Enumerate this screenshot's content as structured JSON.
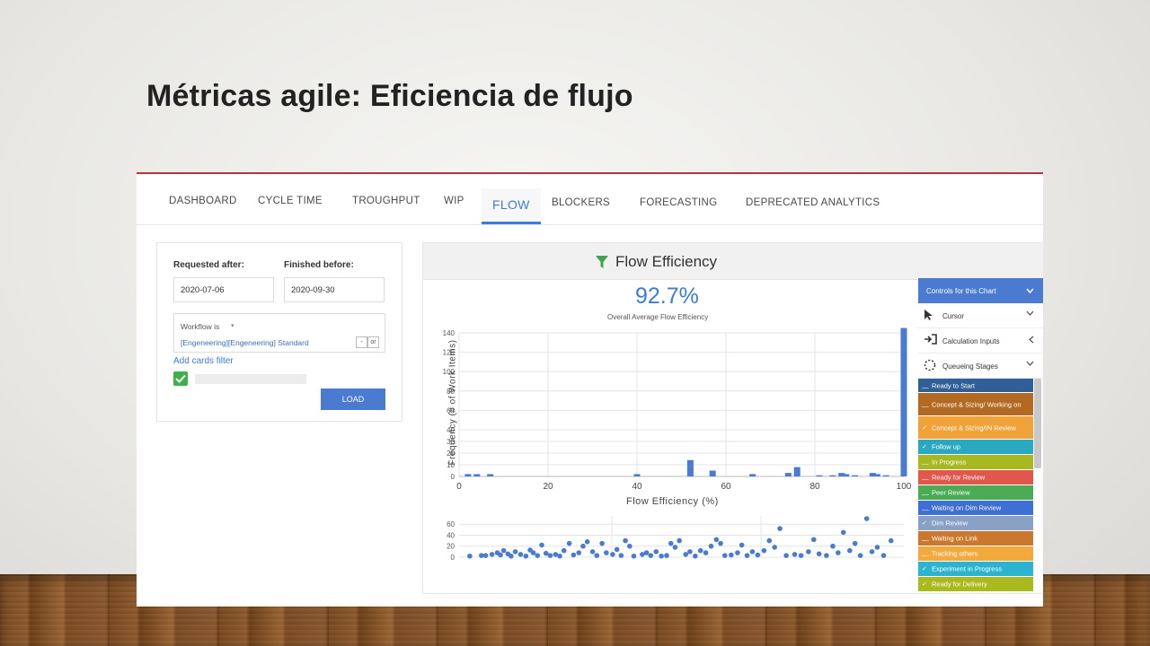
{
  "slide": {
    "title": "Métricas agile: Eficiencia de flujo"
  },
  "tabs": [
    {
      "label": "DASHBOARD"
    },
    {
      "label": "CYCLE TIME"
    },
    {
      "label": "TROUGHPUT"
    },
    {
      "label": "WIP"
    },
    {
      "label": "FLOW"
    },
    {
      "label": "BLOCKERS"
    },
    {
      "label": "FORECASTING"
    },
    {
      "label": "DEPRECATED ANALYTICS"
    }
  ],
  "active_tab": "FLOW",
  "filters": {
    "requested_after_label": "Requested after:",
    "requested_after_value": "2020-07-06",
    "finished_before_label": "Finished before:",
    "finished_before_value": "2020-09-30",
    "workflow_label": "Workflow is",
    "workflow_value": "[Engeneering][Engeneering] Standard",
    "add_filter_label": "Add cards filter",
    "load_label": "LOAD",
    "checkbox_checked": true
  },
  "chart_panel": {
    "title": "Flow Efficiency",
    "metric_value": "92.7%",
    "metric_label": "Overall Average Flow Efficiency"
  },
  "chart_data": [
    {
      "type": "bar",
      "xlabel": "Flow Efficiency (%)",
      "ylabel": "Frequency (# of Work Items)",
      "xlim": [
        0,
        100
      ],
      "ylim": [
        0,
        140
      ],
      "x_ticks": [
        0,
        20,
        40,
        60,
        80,
        100
      ],
      "y_ticks": [
        0,
        10,
        20,
        30,
        40,
        60,
        80,
        100,
        120,
        140
      ],
      "x": [
        2,
        4,
        7,
        40,
        52,
        57,
        66,
        74,
        76,
        81,
        84,
        86,
        87,
        89,
        93,
        94,
        96,
        100
      ],
      "values": [
        2,
        2,
        2,
        2,
        14,
        5,
        2,
        3,
        8,
        1,
        1,
        3,
        2,
        1,
        3,
        2,
        1,
        145
      ],
      "color": "#4a7bd0",
      "grid": true
    },
    {
      "type": "scatter",
      "y_ticks": [
        0,
        20,
        40,
        60
      ],
      "ylim": [
        0,
        75
      ],
      "points": [
        [
          0.5,
          2
        ],
        [
          1.6,
          3
        ],
        [
          2.0,
          3
        ],
        [
          2.6,
          5
        ],
        [
          3.1,
          8
        ],
        [
          3.4,
          4
        ],
        [
          3.7,
          12
        ],
        [
          4.1,
          6
        ],
        [
          4.4,
          2
        ],
        [
          4.8,
          10
        ],
        [
          5.3,
          5
        ],
        [
          5.8,
          2
        ],
        [
          6.2,
          13
        ],
        [
          6.5,
          8
        ],
        [
          6.9,
          3
        ],
        [
          7.3,
          22
        ],
        [
          7.7,
          7
        ],
        [
          8.1,
          3
        ],
        [
          8.6,
          5
        ],
        [
          9.0,
          2
        ],
        [
          9.4,
          12
        ],
        [
          9.9,
          25
        ],
        [
          10.3,
          4
        ],
        [
          10.8,
          8
        ],
        [
          11.2,
          20
        ],
        [
          11.6,
          28
        ],
        [
          12.1,
          10
        ],
        [
          12.5,
          3
        ],
        [
          13.0,
          25
        ],
        [
          13.4,
          8
        ],
        [
          14.0,
          5
        ],
        [
          14.4,
          14
        ],
        [
          14.8,
          3
        ],
        [
          15.2,
          30
        ],
        [
          15.6,
          20
        ],
        [
          16.0,
          2
        ],
        [
          16.8,
          5
        ],
        [
          17.2,
          8
        ],
        [
          17.6,
          3
        ],
        [
          18.1,
          10
        ],
        [
          18.6,
          2
        ],
        [
          19.1,
          3
        ],
        [
          19.5,
          25
        ],
        [
          19.9,
          18
        ],
        [
          20.3,
          30
        ],
        [
          20.9,
          5
        ],
        [
          21.3,
          10
        ],
        [
          21.8,
          2
        ],
        [
          22.3,
          12
        ],
        [
          22.8,
          8
        ],
        [
          23.3,
          20
        ],
        [
          23.8,
          32
        ],
        [
          24.2,
          25
        ],
        [
          24.6,
          3
        ],
        [
          25.2,
          4
        ],
        [
          25.8,
          8
        ],
        [
          26.2,
          22
        ],
        [
          26.7,
          3
        ],
        [
          27.2,
          10
        ],
        [
          27.7,
          4
        ],
        [
          28.3,
          12
        ],
        [
          28.8,
          30
        ],
        [
          29.3,
          18
        ],
        [
          29.8,
          52
        ],
        [
          30.4,
          3
        ],
        [
          31.2,
          5
        ],
        [
          31.8,
          3
        ],
        [
          32.5,
          10
        ],
        [
          33.0,
          32
        ],
        [
          33.5,
          6
        ],
        [
          34.2,
          3
        ],
        [
          34.8,
          20
        ],
        [
          35.3,
          8
        ],
        [
          35.8,
          45
        ],
        [
          36.4,
          12
        ],
        [
          36.9,
          25
        ],
        [
          37.4,
          3
        ],
        [
          38.0,
          70
        ],
        [
          38.5,
          10
        ],
        [
          39.0,
          18
        ],
        [
          39.6,
          3
        ],
        [
          40.3,
          30
        ]
      ],
      "color": "#4a7bd0",
      "grid": true
    }
  ],
  "controls": {
    "header": "Controls for this Chart",
    "items": [
      {
        "label": "Cursor",
        "icon": "cursor-icon"
      },
      {
        "label": "Calculation Inputs",
        "icon": "sign-in-icon"
      },
      {
        "label": "Queueing Stages",
        "icon": "dotted-circle-icon"
      }
    ],
    "stages": [
      {
        "label": "Ready to Start",
        "color": "#2f5f96",
        "mark": "__"
      },
      {
        "label": "Concept & Sizing/ Working on",
        "color": "#b26a22",
        "mark": "__"
      },
      {
        "label": "Concept & Sizing/IN Review",
        "color": "#f1a33a",
        "mark": "✓"
      },
      {
        "label": "Follow up",
        "color": "#2aa7c1",
        "mark": "✓"
      },
      {
        "label": "In Progress",
        "color": "#a7b820",
        "mark": "__"
      },
      {
        "label": "Ready for Review",
        "color": "#e2574c",
        "mark": "__"
      },
      {
        "label": "Peer Review",
        "color": "#4bab55",
        "mark": "__"
      },
      {
        "label": "Waiting on Dim Review",
        "color": "#3d6fd4",
        "mark": "__"
      },
      {
        "label": "Dim Review",
        "color": "#8aa1c6",
        "mark": "✓"
      },
      {
        "label": "Waiting on Link",
        "color": "#c9782e",
        "mark": "__"
      },
      {
        "label": "Tracking others",
        "color": "#f2aa3c",
        "mark": "__"
      },
      {
        "label": "Experiment in Progress",
        "color": "#2bb3d0",
        "mark": "✓"
      },
      {
        "label": "Ready for Delivery",
        "color": "#a9b91e",
        "mark": "✓"
      }
    ]
  }
}
